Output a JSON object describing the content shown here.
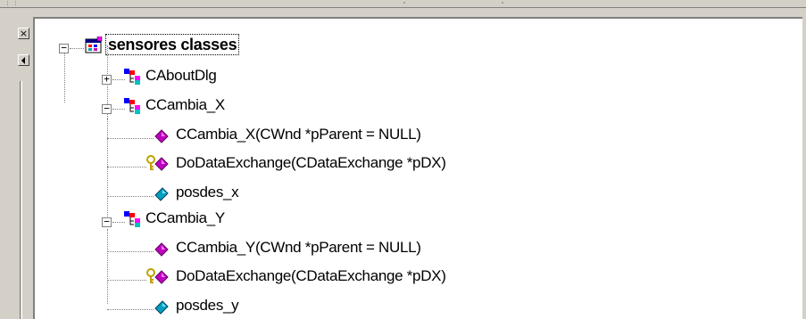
{
  "window": {
    "close_glyph": "×"
  },
  "tree": {
    "root": {
      "label": "sensores classes",
      "icon": "classes-folder-icon",
      "expanded": true
    },
    "classes": [
      {
        "label": "CAboutDlg",
        "expanded": false,
        "members": []
      },
      {
        "label": "CCambia_X",
        "expanded": true,
        "members": [
          {
            "label": "CCambia_X(CWnd *pParent = NULL)",
            "kind": "public-method",
            "icon": "public-method-icon"
          },
          {
            "label": "DoDataExchange(CDataExchange *pDX)",
            "kind": "protected-method",
            "icon": "protected-method-icon"
          },
          {
            "label": "posdes_x",
            "kind": "member-variable",
            "icon": "member-variable-icon"
          }
        ]
      },
      {
        "label": "CCambia_Y",
        "expanded": true,
        "members": [
          {
            "label": "CCambia_Y(CWnd *pParent = NULL)",
            "kind": "public-method",
            "icon": "public-method-icon"
          },
          {
            "label": "DoDataExchange(CDataExchange *pDX)",
            "kind": "protected-method",
            "icon": "protected-method-icon"
          },
          {
            "label": "posdes_y",
            "kind": "member-variable",
            "icon": "member-variable-icon"
          }
        ]
      }
    ]
  },
  "colors": {
    "method": "#c000c0",
    "variable": "#00a0a0",
    "class_blue": "#0000ff",
    "class_red": "#ff0000",
    "class_cyan": "#00c0c0",
    "class_magenta": "#ff00ff",
    "key": "#c0a000"
  }
}
